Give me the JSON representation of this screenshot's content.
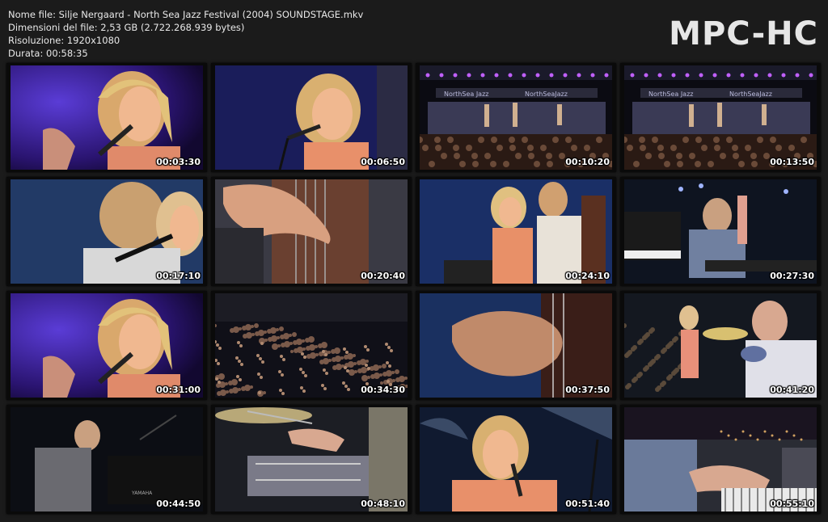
{
  "info": {
    "filename": "Nome file: Silje Nergaard - North Sea Jazz Festival (2004) SOUNDSTAGE.mkv",
    "filesize": "Dimensioni del file: 2,53 GB (2.722.268.939 bytes)",
    "resolution": "Risoluzione: 1920x1080",
    "duration": "Durata: 00:58:35"
  },
  "logo": "MPC-HC",
  "thumbnails": [
    {
      "time": "00:03:30",
      "scene": "singer-closeup-purple"
    },
    {
      "time": "00:06:50",
      "scene": "singer-closeup-blue"
    },
    {
      "time": "00:10:20",
      "scene": "stage-wide"
    },
    {
      "time": "00:13:50",
      "scene": "stage-wide"
    },
    {
      "time": "00:17:10",
      "scene": "singer-duo-closeup"
    },
    {
      "time": "00:20:40",
      "scene": "bass-strings-hand"
    },
    {
      "time": "00:24:10",
      "scene": "singer-and-bassist"
    },
    {
      "time": "00:27:30",
      "scene": "keyboard-player"
    },
    {
      "time": "00:31:00",
      "scene": "singer-closeup-purple"
    },
    {
      "time": "00:34:30",
      "scene": "audience-crowd"
    },
    {
      "time": "00:37:50",
      "scene": "bass-hand-closeup"
    },
    {
      "time": "00:41:20",
      "scene": "singer-and-drummer"
    },
    {
      "time": "00:44:50",
      "scene": "piano-player"
    },
    {
      "time": "00:48:10",
      "scene": "drummer-hands"
    },
    {
      "time": "00:51:40",
      "scene": "singer-front"
    },
    {
      "time": "00:55:10",
      "scene": "keyboard-hands"
    }
  ],
  "colors": {
    "background": "#1b1b1b",
    "text": "#e8e8e8",
    "logo": "#e6e6e6",
    "timestamp": "#ffffff"
  }
}
